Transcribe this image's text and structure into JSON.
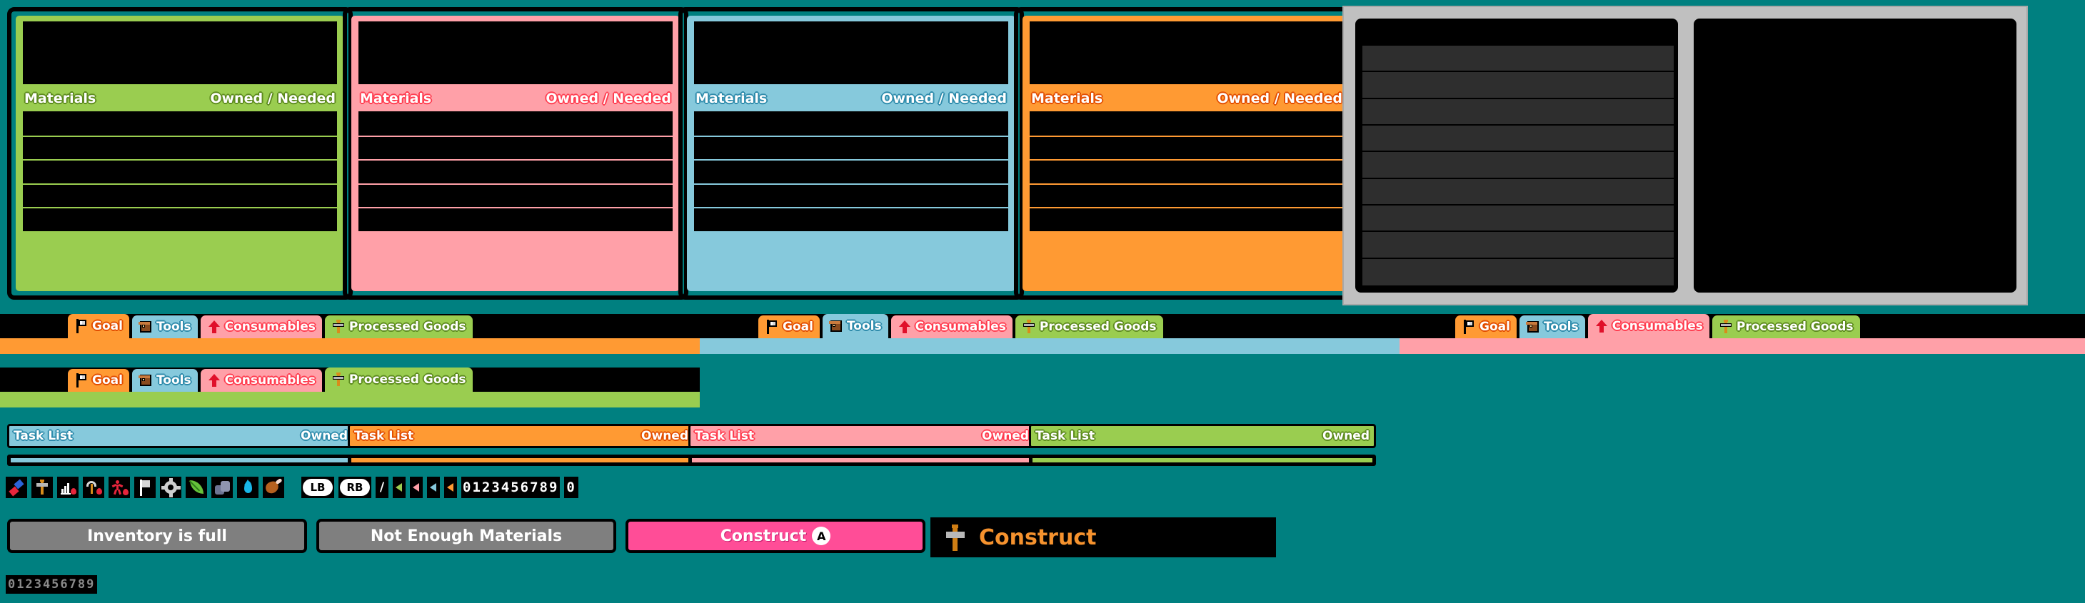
{
  "theme": {
    "background": "#008080",
    "green": "#9acd50",
    "green_dark": "#5d8b1e",
    "pink": "#ffa0a8",
    "pink_dark": "#ff3c4f",
    "cyan": "#86c9dc",
    "cyan_dark": "#2e8bab",
    "orange": "#ff9a33",
    "orange_dark": "#e24d00",
    "gray_panel": "#c0c0c0",
    "gray_row": "#2e2e2e",
    "button_gray": "#7f7f7f",
    "button_pink": "#ff4d97",
    "construct_orange": "#f5922e",
    "black": "#000000"
  },
  "material_panels": [
    {
      "accent": "green",
      "title": "Materials",
      "value_header": "Owned / Needed",
      "rows": 5
    },
    {
      "accent": "pink",
      "title": "Materials",
      "value_header": "Owned / Needed",
      "rows": 5
    },
    {
      "accent": "cyan",
      "title": "Materials",
      "value_header": "Owned / Needed",
      "rows": 5
    },
    {
      "accent": "orange",
      "title": "Materials",
      "value_header": "Owned / Needed",
      "rows": 5
    }
  ],
  "gray_panel": {
    "left_rows": 9,
    "right_empty": true
  },
  "tab_bars": [
    {
      "active_index": 0,
      "underline_color": "#ff9a33",
      "tabs": [
        {
          "label": "Goal",
          "icon": "flag-icon",
          "theme": "goal"
        },
        {
          "label": "Tools",
          "icon": "chest-icon",
          "theme": "tools"
        },
        {
          "label": "Consumables",
          "icon": "arrow-up-icon",
          "theme": "cons"
        },
        {
          "label": "Processed Goods",
          "icon": "hammer-icon",
          "theme": "proc"
        }
      ]
    },
    {
      "active_index": 1,
      "underline_color": "#86c9dc",
      "tabs": [
        {
          "label": "Goal",
          "icon": "flag-icon",
          "theme": "goal"
        },
        {
          "label": "Tools",
          "icon": "chest-icon",
          "theme": "tools"
        },
        {
          "label": "Consumables",
          "icon": "arrow-up-icon",
          "theme": "cons"
        },
        {
          "label": "Processed Goods",
          "icon": "hammer-icon",
          "theme": "proc"
        }
      ]
    },
    {
      "active_index": 2,
      "underline_color": "#ffa0a8",
      "tabs": [
        {
          "label": "Goal",
          "icon": "flag-icon",
          "theme": "goal"
        },
        {
          "label": "Tools",
          "icon": "chest-icon",
          "theme": "tools"
        },
        {
          "label": "Consumables",
          "icon": "arrow-up-icon",
          "theme": "cons"
        },
        {
          "label": "Processed Goods",
          "icon": "hammer-icon",
          "theme": "proc"
        }
      ]
    },
    {
      "active_index": 3,
      "underline_color": "#9acd50",
      "tabs": [
        {
          "label": "Goal",
          "icon": "flag-icon",
          "theme": "goal"
        },
        {
          "label": "Tools",
          "icon": "chest-icon",
          "theme": "tools"
        },
        {
          "label": "Consumables",
          "icon": "arrow-up-icon",
          "theme": "cons"
        },
        {
          "label": "Processed Goods",
          "icon": "hammer-icon",
          "theme": "proc"
        }
      ]
    }
  ],
  "task_lists": [
    {
      "accent": "cyan",
      "title": "Task List",
      "value_header": "Owned"
    },
    {
      "accent": "orange",
      "title": "Task List",
      "value_header": "Owned"
    },
    {
      "accent": "pink",
      "title": "Task List",
      "value_header": "Owned"
    },
    {
      "accent": "green",
      "title": "Task List",
      "value_header": "Owned"
    }
  ],
  "icon_strip": {
    "icons": [
      "pill-icon",
      "hammer-icon",
      "chart-bars-icon",
      "pickaxe-icon",
      "person-icon",
      "flag-icon",
      "gear-icon",
      "leaf-icon",
      "rock-icon",
      "water-drop-icon",
      "meat-icon"
    ],
    "bumpers": [
      {
        "label": "LB",
        "name": "lb-bumper"
      },
      {
        "label": "RB",
        "name": "rb-bumper"
      }
    ],
    "slash": "/",
    "arrows": [
      {
        "name": "left-arrow-green",
        "color": "#9acd50"
      },
      {
        "name": "left-arrow-pink",
        "color": "#ffa0a8"
      },
      {
        "name": "left-arrow-cyan",
        "color": "#86c9dc"
      },
      {
        "name": "left-arrow-orange",
        "color": "#ff9a33"
      }
    ],
    "digits": "0123456789",
    "digit_single": "0"
  },
  "buttons": [
    {
      "label": "Inventory is full",
      "style": "gray",
      "badge": null
    },
    {
      "label": "Not Enough Materials",
      "style": "gray",
      "badge": null
    },
    {
      "label": "Construct",
      "style": "pink",
      "badge": "A"
    }
  ],
  "construct_bar": {
    "label": "Construct",
    "icon": "hammer-icon"
  },
  "bottom_digits": "0123456789"
}
